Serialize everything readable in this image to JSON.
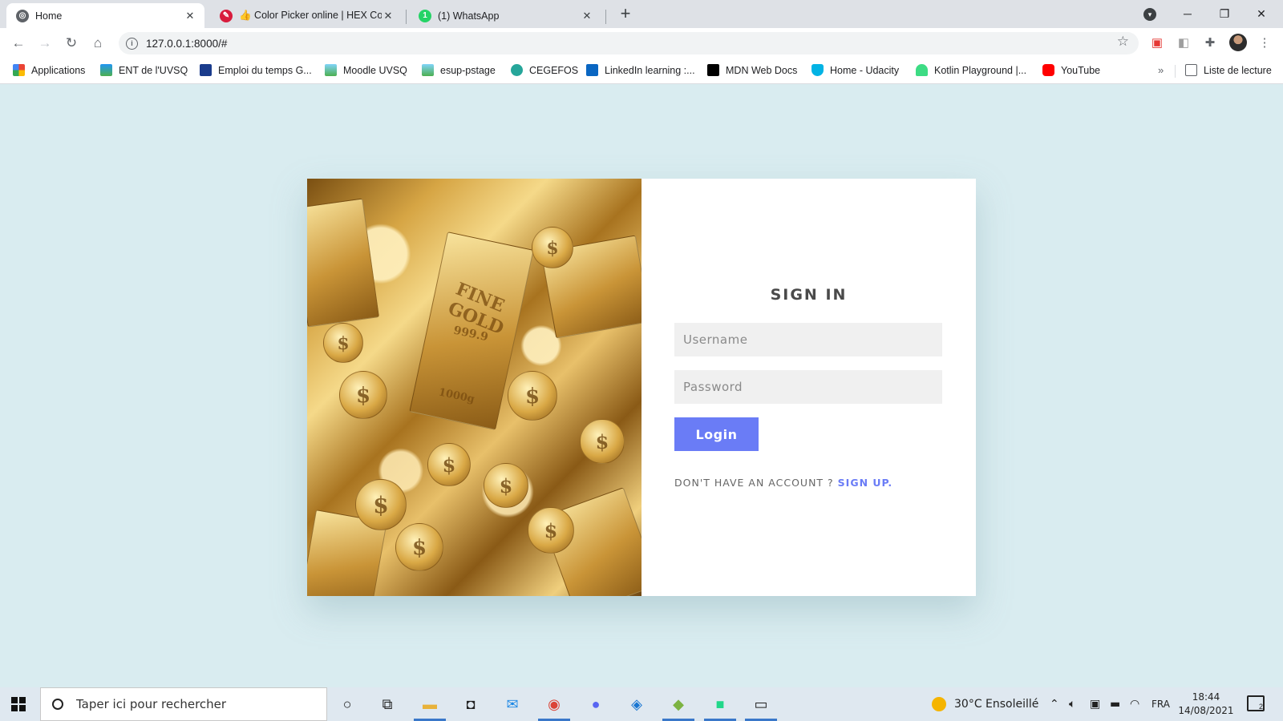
{
  "browser": {
    "tabs": [
      {
        "title": "Home",
        "active": true,
        "icon": "globe-icon"
      },
      {
        "title": "👍 Color Picker online | HEX Color",
        "active": false,
        "icon": "color-picker-icon"
      },
      {
        "title": "(1) WhatsApp",
        "active": false,
        "icon": "whatsapp-icon"
      }
    ],
    "new_tab": "+",
    "url": "127.0.0.1:8000/#",
    "window_controls": {
      "minimize": "─",
      "restore": "❐",
      "close": "✕"
    },
    "bookmarks": [
      {
        "label": "Applications",
        "icon": "apps-grid-icon",
        "color": "#4285f4"
      },
      {
        "label": "ENT de l'UVSQ",
        "icon": "ent-icon",
        "color": "#3aa76d"
      },
      {
        "label": "Emploi du temps G...",
        "icon": "calendar-icon",
        "color": "#1a3c8c"
      },
      {
        "label": "Moodle UVSQ",
        "icon": "moodle-icon",
        "color": "#4caf50"
      },
      {
        "label": "esup-pstage",
        "icon": "esup-icon",
        "color": "#4caf50"
      },
      {
        "label": "CEGEFOS",
        "icon": "cegefos-icon",
        "color": "#26a69a"
      },
      {
        "label": "LinkedIn learning :...",
        "icon": "linkedin-learning-icon",
        "color": "#0a66c2"
      },
      {
        "label": "MDN Web Docs",
        "icon": "mdn-icon",
        "color": "#000000"
      },
      {
        "label": "Home - Udacity",
        "icon": "udacity-icon",
        "color": "#02b3e4"
      },
      {
        "label": "Kotlin Playground |...",
        "icon": "android-icon",
        "color": "#3ddc84"
      },
      {
        "label": "YouTube",
        "icon": "youtube-icon",
        "color": "#ff0000"
      }
    ],
    "bookmarks_more": "»",
    "reading_list": "Liste de lecture"
  },
  "login": {
    "title": "SIGN IN",
    "username_placeholder": "Username",
    "password_placeholder": "Password",
    "login_button": "Login",
    "no_account_text": "DON'T HAVE AN ACCOUNT ?",
    "signup_link": "SIGN UP."
  },
  "image_text": {
    "fine_gold": "FINE GOLD",
    "purity": "999.9",
    "weight": "1000g",
    "coin_symbol": "$"
  },
  "taskbar": {
    "search_placeholder": "Taper ici pour rechercher",
    "weather": "30°C  Ensoleillé",
    "language": "FRA",
    "time": "18:44",
    "date": "14/08/2021",
    "notifications": "2"
  },
  "colors": {
    "accent": "#6a7cf6",
    "page_background": "#d9ecf0"
  }
}
